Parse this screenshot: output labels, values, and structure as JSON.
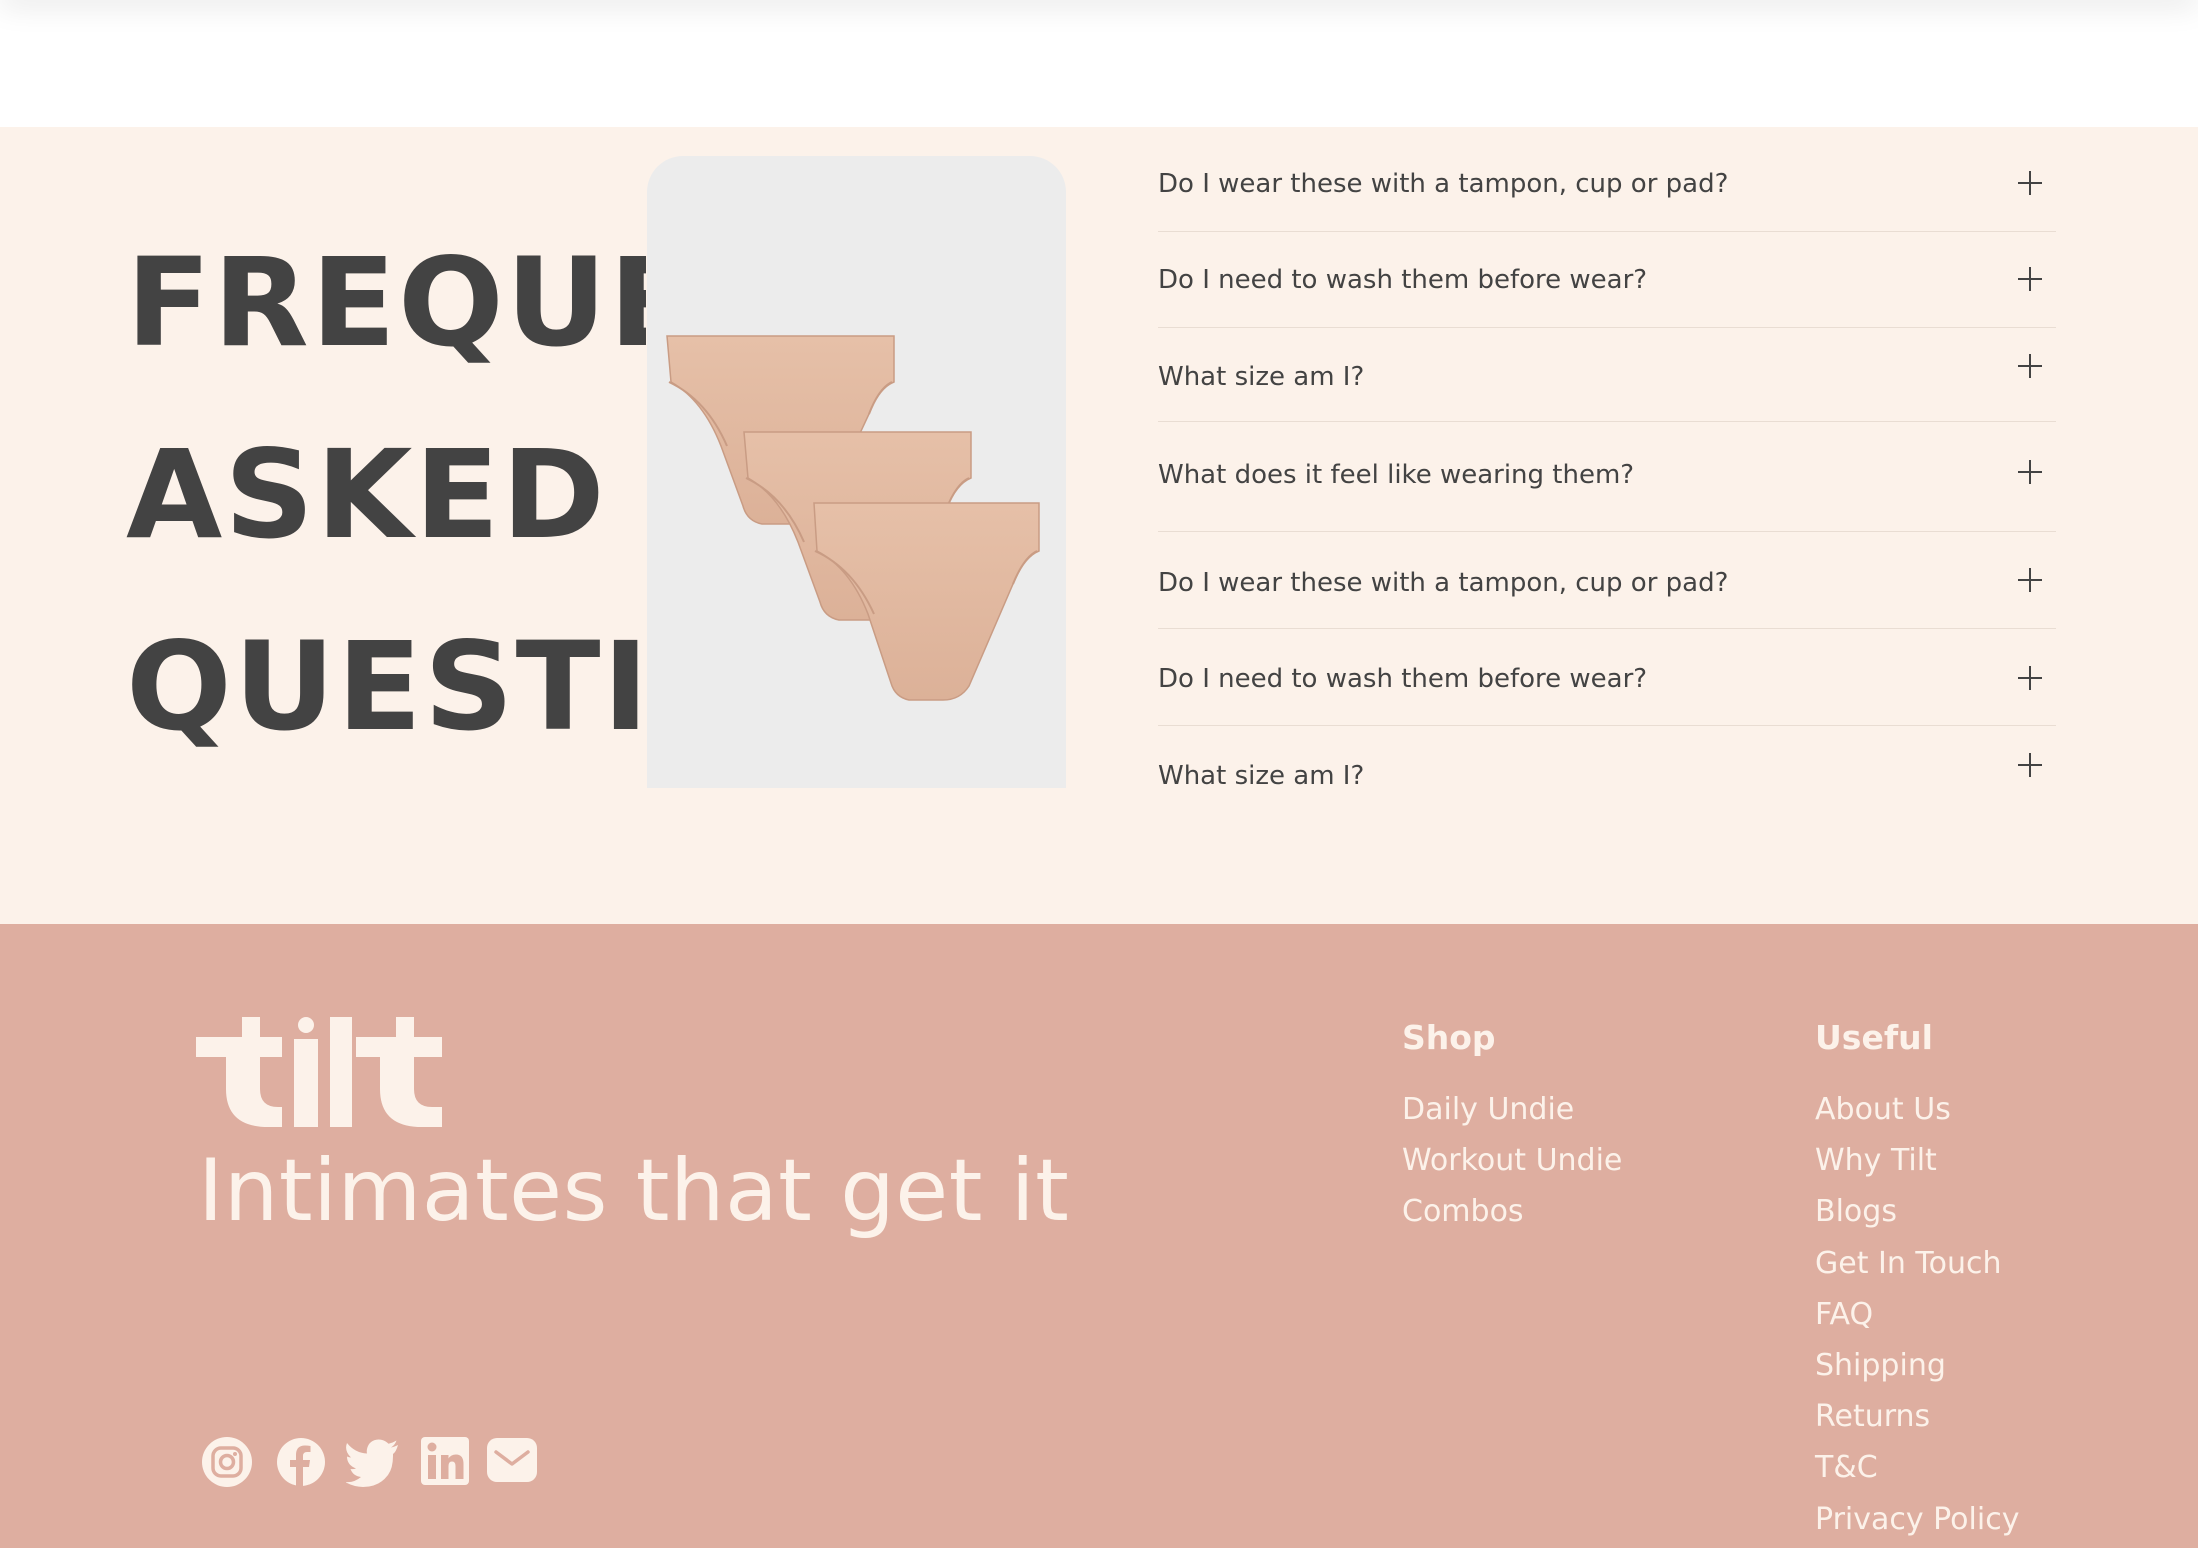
{
  "faq": {
    "heading_lines": [
      "FREQUENTLY",
      "ASKED",
      "QUESTIONS"
    ],
    "items": [
      {
        "question": "Do I wear these with a tampon, cup or pad?"
      },
      {
        "question": "Do I need to wash them before wear?"
      },
      {
        "question": "What size am I?"
      },
      {
        "question": "What does it feel like wearing them?"
      },
      {
        "question": "Do I wear these with a tampon, cup or pad?"
      },
      {
        "question": "Do I need to wash them before wear?"
      },
      {
        "question": "What size am I?"
      }
    ],
    "expand_icon": "plus-icon"
  },
  "footer": {
    "logo_text": "tilt",
    "tagline": "Intimates that get it",
    "shop": {
      "title": "Shop",
      "links": [
        "Daily Undie",
        "Workout Undie",
        "Combos"
      ]
    },
    "useful": {
      "title": "Useful",
      "links": [
        "About Us",
        "Why Tilt",
        "Blogs",
        "Get In Touch",
        "FAQ",
        "Shipping",
        "Returns",
        "T&C",
        "Privacy Policy"
      ]
    },
    "socials": [
      "instagram-icon",
      "facebook-icon",
      "twitter-icon",
      "linkedin-icon",
      "email-icon"
    ]
  },
  "colors": {
    "faq_background": "#fcf2ea",
    "footer_background": "#deaea0",
    "footer_text": "#fcf2ea",
    "heading_text": "#434343",
    "product_card": "#ececec",
    "product_fabric": "#e2b9a0"
  }
}
